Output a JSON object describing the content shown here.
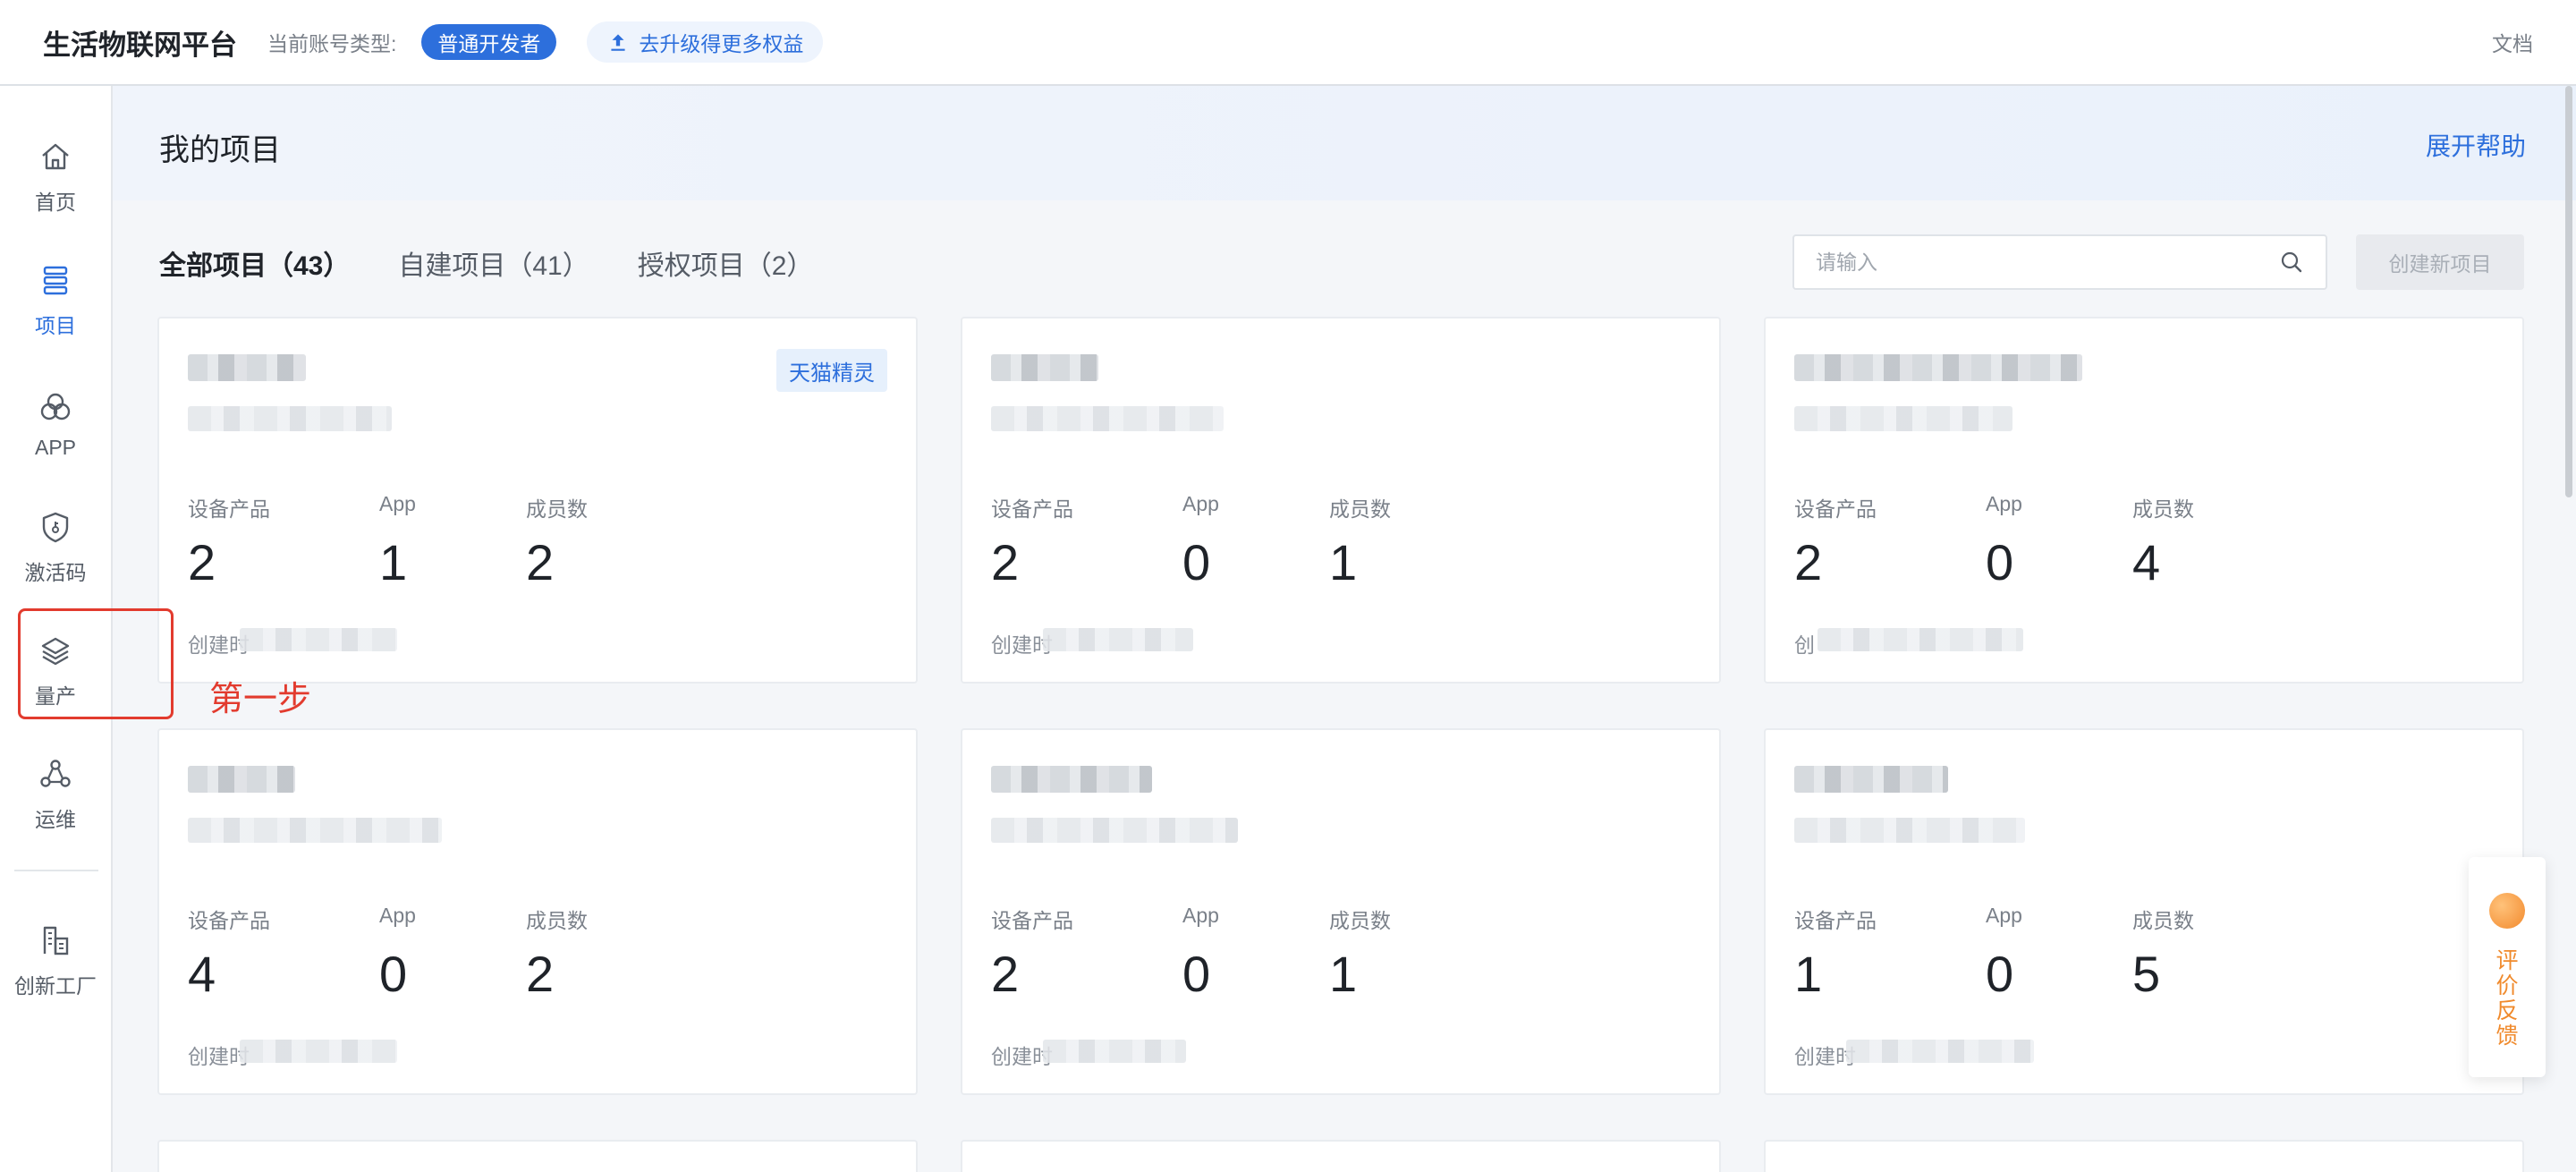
{
  "header": {
    "brand": "生活物联网平台",
    "account_type_label": "当前账号类型:",
    "account_type": "普通开发者",
    "upgrade_label": "去升级得更多权益",
    "docs_label": "文档"
  },
  "sidebar": {
    "items": [
      {
        "label": "首页",
        "icon": "home-icon"
      },
      {
        "label": "项目",
        "icon": "project-icon",
        "active": true
      },
      {
        "label": "APP",
        "icon": "app-icon"
      },
      {
        "label": "激活码",
        "icon": "activation-code-icon"
      },
      {
        "label": "量产",
        "icon": "mass-production-icon"
      },
      {
        "label": "运维",
        "icon": "operations-icon"
      },
      {
        "label": "创新工厂",
        "icon": "factory-icon"
      }
    ]
  },
  "main": {
    "title": "我的项目",
    "help_label": "展开帮助",
    "tabs": [
      {
        "label": "全部项目（43）",
        "active": true
      },
      {
        "label": "自建项目（41）"
      },
      {
        "label": "授权项目（2）"
      }
    ],
    "search_placeholder": "请输入",
    "create_label": "创建新项目",
    "stat_labels": {
      "products": "设备产品",
      "app": "App",
      "members": "成员数"
    },
    "created_prefix": "创建时",
    "created_prefix_short": "创",
    "projects": [
      {
        "tag": "天猫精灵",
        "products": "2",
        "app": "1",
        "members": "2"
      },
      {
        "products": "2",
        "app": "0",
        "members": "1"
      },
      {
        "products": "2",
        "app": "0",
        "members": "4"
      },
      {
        "products": "4",
        "app": "0",
        "members": "2"
      },
      {
        "products": "2",
        "app": "0",
        "members": "1"
      },
      {
        "products": "1",
        "app": "0",
        "members": "5"
      }
    ]
  },
  "annotation": {
    "step_label": "第一步"
  },
  "feedback": {
    "label": "评价反馈"
  },
  "colors": {
    "accent": "#2d6fdc",
    "annotation": "#e23b2e",
    "feedback": "#f08a2c"
  }
}
